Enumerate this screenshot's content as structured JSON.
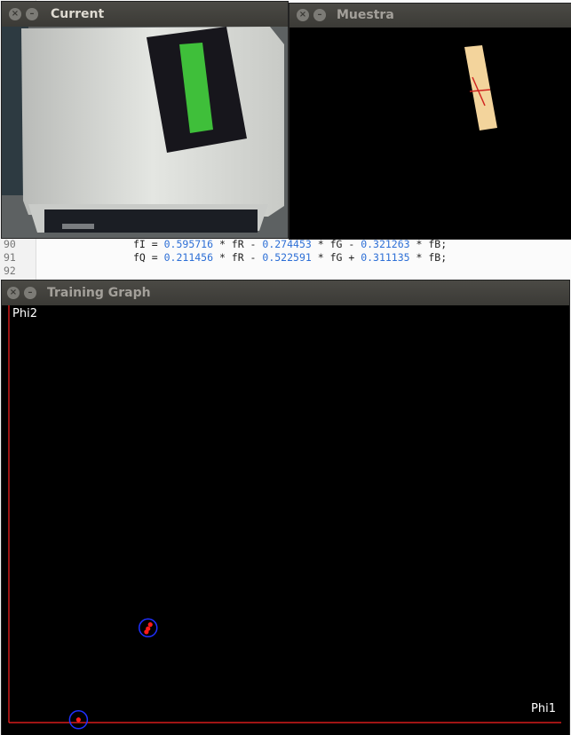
{
  "editor": {
    "lines": [
      {
        "n": "90",
        "segments": [
          {
            "t": "fI = "
          },
          {
            "t": "0.595716",
            "num": true
          },
          {
            "t": " * fR - "
          },
          {
            "t": "0.274453",
            "num": true
          },
          {
            "t": " * fG - "
          },
          {
            "t": "0.321263",
            "num": true
          },
          {
            "t": " * fB;"
          }
        ]
      },
      {
        "n": "91",
        "segments": [
          {
            "t": "fQ = "
          },
          {
            "t": "0.211456",
            "num": true
          },
          {
            "t": " * fR - "
          },
          {
            "t": "0.522591",
            "num": true
          },
          {
            "t": " * fG + "
          },
          {
            "t": "0.311135",
            "num": true
          },
          {
            "t": " * fB;"
          }
        ]
      },
      {
        "n": "92",
        "segments": []
      }
    ]
  },
  "windows": {
    "current": {
      "title": "Current"
    },
    "muestra": {
      "title": "Muestra"
    },
    "training": {
      "title": "Training Graph",
      "y_label": "Phi2",
      "x_label": "Phi1"
    }
  },
  "colors": {
    "axis": "#ff2020",
    "point": "#ff1a1a",
    "cluster_ring": "#2030ff",
    "sample_patch": "#f3d49c",
    "green_strip": "#3fbf3a"
  },
  "chart_data": {
    "type": "scatter",
    "xlabel": "Phi1",
    "ylabel": "Phi2",
    "points": [
      {
        "x": 0.126,
        "y": 0.007
      },
      {
        "x": 0.256,
        "y": 0.24
      },
      {
        "x": 0.252,
        "y": 0.23
      },
      {
        "x": 0.249,
        "y": 0.222
      }
    ],
    "clusters": [
      {
        "x": 0.126,
        "y": 0.007
      },
      {
        "x": 0.252,
        "y": 0.232
      }
    ],
    "xlim": [
      0,
      1
    ],
    "ylim": [
      0,
      1
    ]
  }
}
